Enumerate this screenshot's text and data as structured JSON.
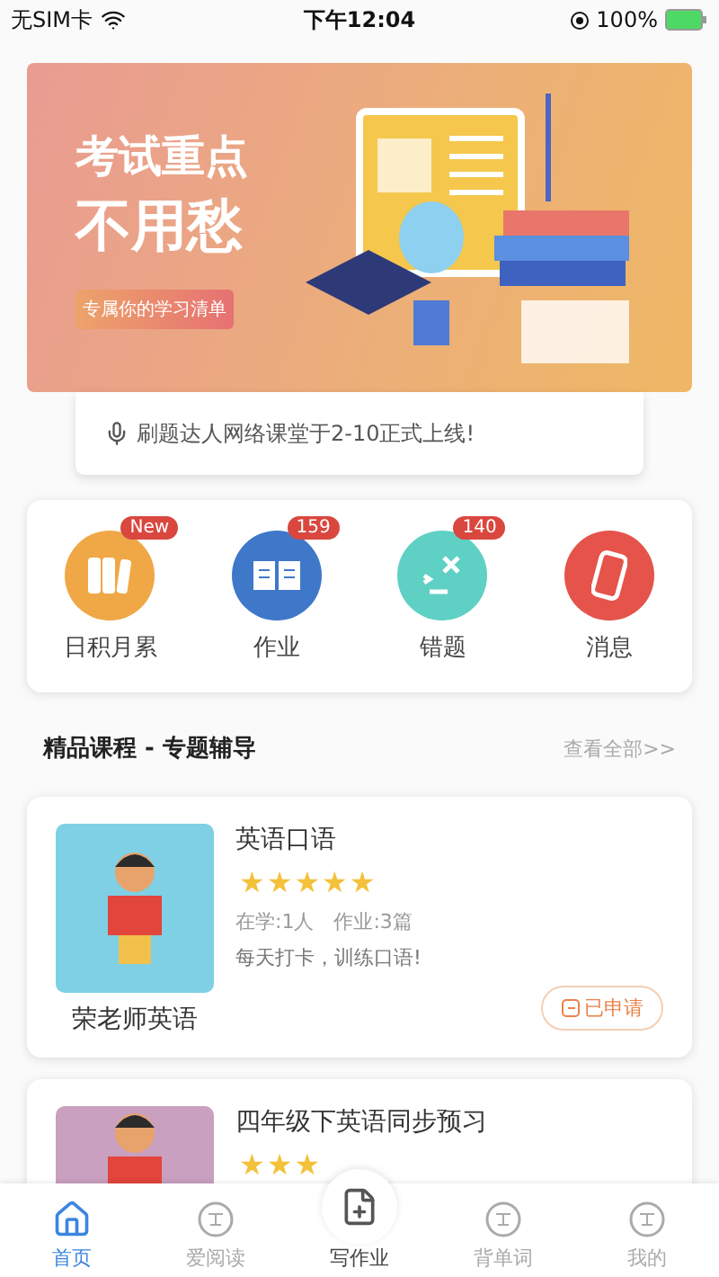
{
  "status_bar": {
    "carrier": "无SIM卡",
    "time": "下午12:04",
    "battery": "100%"
  },
  "banner": {
    "title_line_1": "考试重点",
    "title_line_2": "不用愁",
    "tag": "专属你的学习清单"
  },
  "notice": {
    "text": "刷题达人网络课堂于2-10正式上线!"
  },
  "shortcuts": [
    {
      "label": "日积月累",
      "badge": "New",
      "color": "#f0a847"
    },
    {
      "label": "作业",
      "badge": "159",
      "color": "#3f78c9"
    },
    {
      "label": "错题",
      "badge": "140",
      "color": "#5fd0c4"
    },
    {
      "label": "消息",
      "color": "#e5534a"
    }
  ],
  "section": {
    "title": "精品课程 - 专题辅导",
    "more": "查看全部>>"
  },
  "courses": [
    {
      "title": "英语口语",
      "stars": 5,
      "students": "在学:1人",
      "homework": "作业:3篇",
      "slogan": "每天打卡，训练口语!",
      "teacher": "荣老师英语",
      "button": "已申请"
    },
    {
      "title": "四年级下英语同步预习",
      "stars": 3
    }
  ],
  "tab_bar": [
    {
      "label": "首页",
      "selected": true
    },
    {
      "label": "爱阅读",
      "selected": false
    },
    {
      "label": "写作业",
      "selected": false,
      "kind": "center"
    },
    {
      "label": "背单词",
      "selected": false
    },
    {
      "label": "我的",
      "selected": false
    }
  ]
}
